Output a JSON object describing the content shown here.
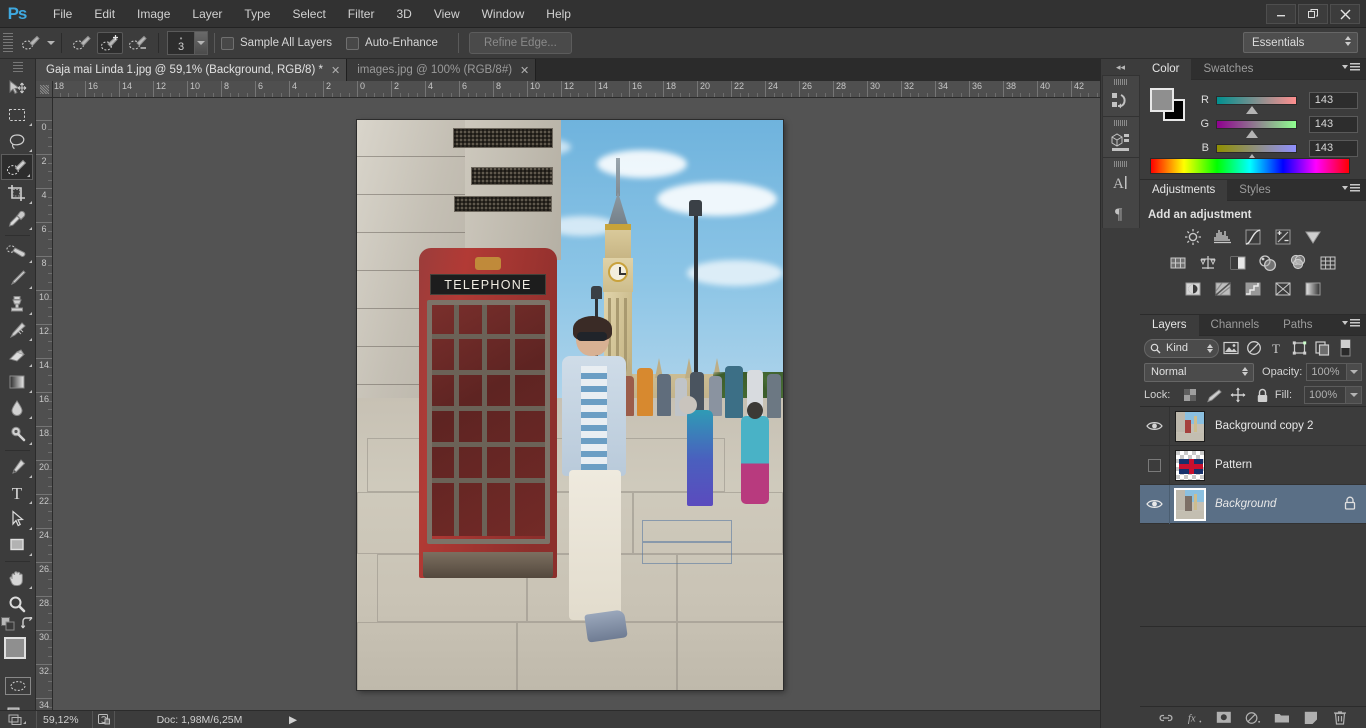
{
  "app": {
    "name": "Adobe Photoshop",
    "logo_text": "Ps"
  },
  "titlebar": {
    "menus": [
      "File",
      "Edit",
      "Image",
      "Layer",
      "Type",
      "Select",
      "Filter",
      "3D",
      "View",
      "Window",
      "Help"
    ],
    "window_controls": [
      {
        "name": "minimize",
        "glyph": "—"
      },
      {
        "name": "restore",
        "glyph": "❐"
      },
      {
        "name": "close",
        "glyph": "✕"
      }
    ]
  },
  "options_bar": {
    "tool_preset_icon": "quick-selection-tool-icon",
    "mode_buttons": [
      "new-selection",
      "add-to-selection",
      "subtract-from-selection"
    ],
    "active_mode_index": 1,
    "brush_size": "3",
    "sample_all_layers": {
      "label": "Sample All Layers",
      "checked": false
    },
    "auto_enhance": {
      "label": "Auto-Enhance",
      "checked": false
    },
    "refine_edge": {
      "label": "Refine Edge...",
      "enabled": false
    },
    "workspace": {
      "label": "Essentials"
    }
  },
  "toolbox": {
    "tools": [
      {
        "name": "move-tool",
        "icon": "move-arrow-icon",
        "has_submenu": false,
        "active": false
      },
      {
        "name": "rectangular-marquee-tool",
        "icon": "marquee-rect-icon",
        "has_submenu": true,
        "active": false
      },
      {
        "name": "lasso-tool",
        "icon": "lasso-icon",
        "has_submenu": true,
        "active": false
      },
      {
        "name": "quick-selection-tool",
        "icon": "quick-selection-icon",
        "has_submenu": true,
        "active": true
      },
      {
        "name": "crop-tool",
        "icon": "crop-icon",
        "has_submenu": true,
        "active": false
      },
      {
        "name": "eyedropper-tool",
        "icon": "eyedropper-icon",
        "has_submenu": true,
        "active": false
      },
      {
        "name": "spot-healing-brush-tool",
        "icon": "healing-brush-icon",
        "has_submenu": true,
        "active": false
      },
      {
        "name": "brush-tool",
        "icon": "brush-icon",
        "has_submenu": true,
        "active": false
      },
      {
        "name": "clone-stamp-tool",
        "icon": "clone-stamp-icon",
        "has_submenu": true,
        "active": false
      },
      {
        "name": "history-brush-tool",
        "icon": "history-brush-icon",
        "has_submenu": true,
        "active": false
      },
      {
        "name": "eraser-tool",
        "icon": "eraser-icon",
        "has_submenu": true,
        "active": false
      },
      {
        "name": "gradient-tool",
        "icon": "gradient-icon",
        "has_submenu": true,
        "active": false
      },
      {
        "name": "blur-tool",
        "icon": "blur-drop-icon",
        "has_submenu": true,
        "active": false
      },
      {
        "name": "dodge-tool",
        "icon": "dodge-icon",
        "has_submenu": true,
        "active": false
      },
      {
        "name": "pen-tool",
        "icon": "pen-icon",
        "has_submenu": true,
        "active": false
      },
      {
        "name": "horizontal-type-tool",
        "icon": "type-T-icon",
        "has_submenu": true,
        "active": false
      },
      {
        "name": "path-selection-tool",
        "icon": "path-arrow-icon",
        "has_submenu": true,
        "active": false
      },
      {
        "name": "rectangle-tool",
        "icon": "rectangle-shape-icon",
        "has_submenu": true,
        "active": false
      },
      {
        "name": "hand-tool",
        "icon": "hand-icon",
        "has_submenu": true,
        "active": false
      },
      {
        "name": "zoom-tool",
        "icon": "magnifier-icon",
        "has_submenu": false,
        "active": false
      }
    ],
    "default_colors_icon": "default-colors-icon",
    "swap_colors_icon": "swap-colors-icon",
    "foreground_color": "#8f8f8f",
    "background_color": "#000000",
    "quick_mask_icon": "quick-mask-icon",
    "screen_mode_icon": "screen-mode-icon"
  },
  "documents": {
    "tabs": [
      {
        "title": "Gaja mai Linda 1.jpg @ 59,1% (Background, RGB/8) *",
        "active": true,
        "close_glyph": "✕"
      },
      {
        "title": "images.jpg @ 100% (RGB/8#)",
        "active": false,
        "close_glyph": "✕"
      }
    ]
  },
  "rulers": {
    "horizontal_labels": [
      "18",
      "16",
      "14",
      "12",
      "10",
      "8",
      "6",
      "4",
      "2",
      "0",
      "2",
      "4",
      "6",
      "8",
      "10",
      "12",
      "14",
      "16",
      "18",
      "20",
      "22",
      "24",
      "26",
      "28",
      "30",
      "32",
      "34",
      "36",
      "38",
      "40",
      "42"
    ],
    "vertical_labels": [
      "0",
      "2",
      "4",
      "6",
      "8",
      "10",
      "12",
      "14",
      "16",
      "18",
      "20",
      "22",
      "24",
      "26",
      "28",
      "30",
      "32",
      "34"
    ]
  },
  "canvas": {
    "image_alt": "London street photo with red telephone box, Big Ben and a woman leaning on the booth",
    "telephone_sign": "TELEPHONE"
  },
  "status_bar": {
    "zoom": "59,12%",
    "preview_icon": "document-preview-icon",
    "doc_info": "Doc: 1,98M/6,25M",
    "expand_arrow": "▶",
    "resize_icon": "resize-grip-icon"
  },
  "icon_dock": {
    "collapse_glyph": "◂◂",
    "items": [
      {
        "name": "history-panel-icon",
        "label": "History"
      },
      {
        "name": "3d-panel-icon",
        "label": "3D"
      },
      {
        "name": "character-panel-icon",
        "label": "Character"
      },
      {
        "name": "paragraph-panel-icon",
        "label": "Paragraph"
      }
    ]
  },
  "color_panel": {
    "tabs": [
      {
        "label": "Color",
        "active": true
      },
      {
        "label": "Swatches",
        "active": false
      }
    ],
    "menu_icon": "panel-menu-icon",
    "foreground_color": "#8f8f8f",
    "background_color": "#000000",
    "channels": [
      {
        "label": "R",
        "value": "143"
      },
      {
        "label": "G",
        "value": "143"
      },
      {
        "label": "B",
        "value": "143"
      }
    ]
  },
  "adjustments_panel": {
    "tabs": [
      {
        "label": "Adjustments",
        "active": true
      },
      {
        "label": "Styles",
        "active": false
      }
    ],
    "menu_icon": "panel-menu-icon",
    "heading": "Add an adjustment",
    "rows": [
      [
        "brightness-contrast-icon",
        "levels-icon",
        "curves-icon",
        "exposure-icon",
        "vibrance-icon"
      ],
      [
        "hue-saturation-icon",
        "color-balance-icon",
        "black-white-icon",
        "photo-filter-icon",
        "channel-mixer-icon",
        "color-lookup-icon"
      ],
      [
        "invert-icon",
        "posterize-icon",
        "threshold-icon",
        "selective-color-icon",
        "gradient-map-icon"
      ]
    ]
  },
  "layers_panel": {
    "tabs": [
      {
        "label": "Layers",
        "active": true
      },
      {
        "label": "Channels",
        "active": false
      },
      {
        "label": "Paths",
        "active": false
      }
    ],
    "menu_icon": "panel-menu-icon",
    "filter": {
      "kind_label": "Kind",
      "search_icon": "search-icon",
      "type_filters": [
        "filter-pixel-icon",
        "filter-adjustment-icon",
        "filter-type-icon",
        "filter-shape-icon",
        "filter-smartobject-icon"
      ],
      "toggle_icon": "filter-toggle-icon"
    },
    "blend_mode": "Normal",
    "opacity": {
      "label": "Opacity:",
      "value": "100%"
    },
    "fill": {
      "label": "Fill:",
      "value": "100%"
    },
    "lock": {
      "label": "Lock:",
      "icons": [
        "lock-transparent-pixels-icon",
        "lock-image-pixels-icon",
        "lock-position-icon",
        "lock-all-icon"
      ]
    },
    "layers": [
      {
        "name": "Background copy 2",
        "visible": true,
        "selected": false,
        "locked": false,
        "italic": false,
        "thumb": "photo"
      },
      {
        "name": "Pattern",
        "visible": false,
        "selected": false,
        "locked": false,
        "italic": false,
        "thumb": "pattern"
      },
      {
        "name": "Background",
        "visible": true,
        "selected": true,
        "locked": true,
        "italic": true,
        "thumb": "photo"
      }
    ],
    "footer_icons": [
      "link-layers-icon",
      "layer-style-fx-icon",
      "add-layer-mask-icon",
      "new-adjustment-layer-icon",
      "new-group-icon",
      "new-layer-icon",
      "delete-layer-icon"
    ]
  },
  "colors": {
    "panel_bg": "#3c3c3c",
    "app_bg": "#535353",
    "titlebar_bg": "#323232",
    "selection_blue": "#5a6f86",
    "accent_blue": "#3fa9e0",
    "text": "#c8c8c8"
  }
}
